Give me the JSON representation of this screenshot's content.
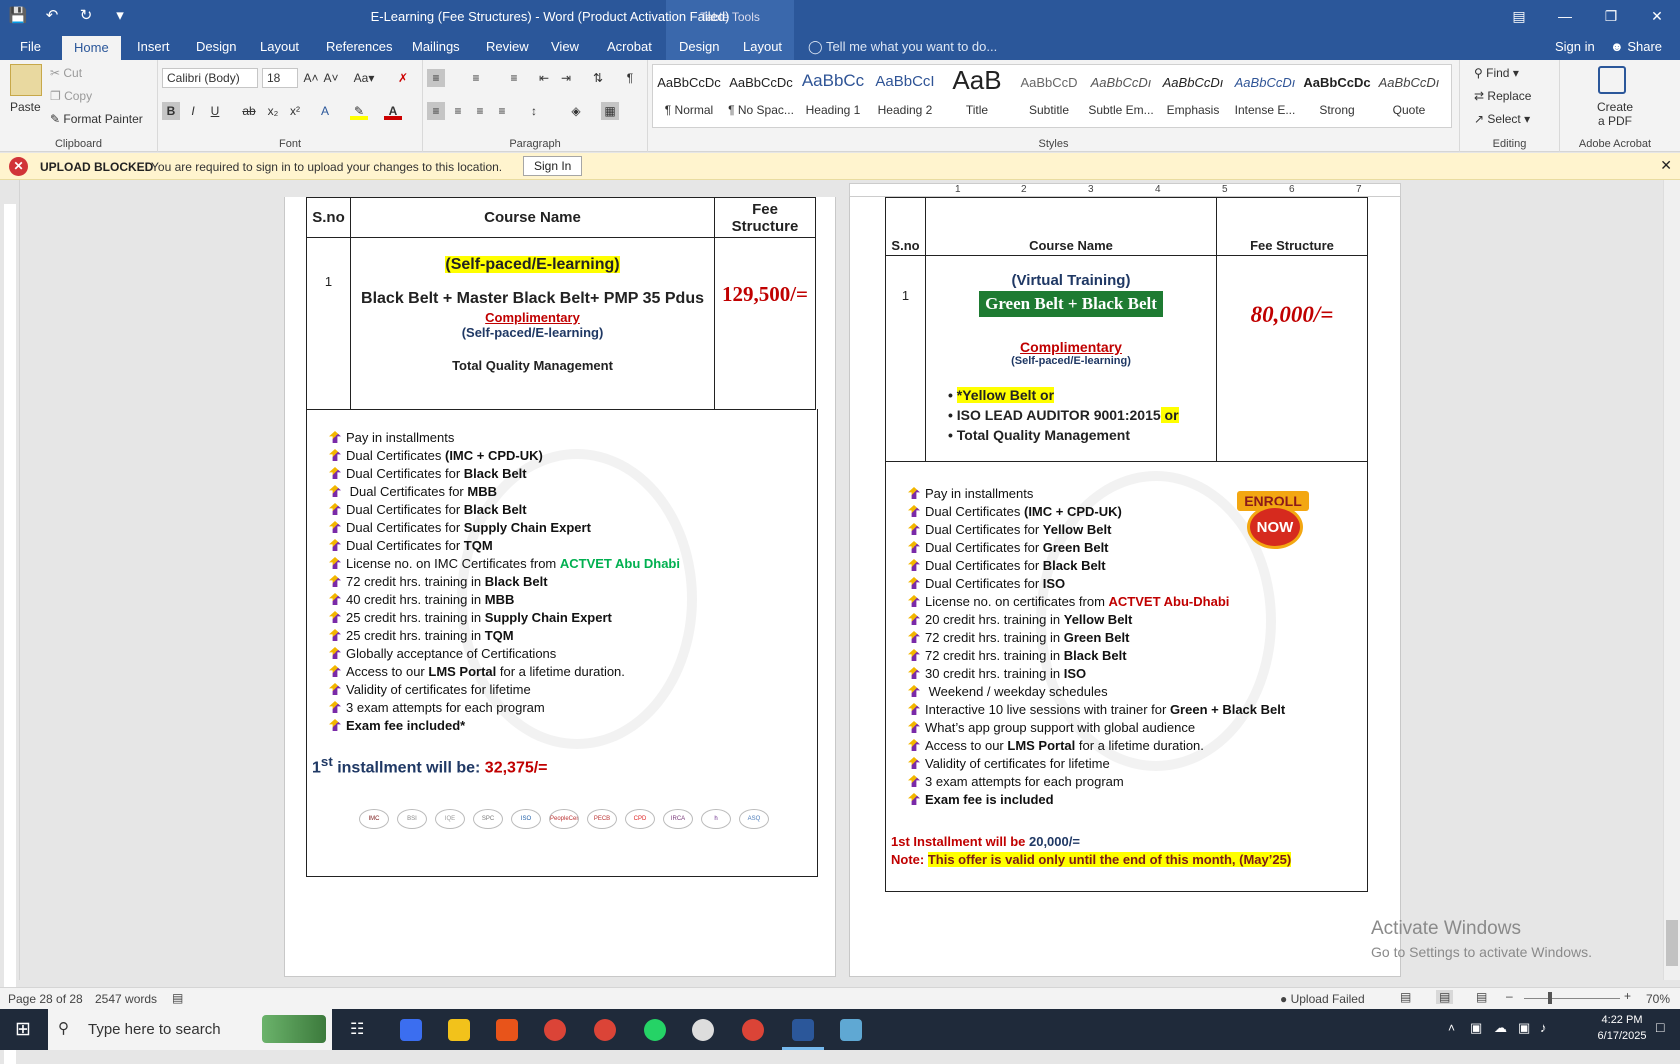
{
  "window": {
    "title": "E-Learning (Fee Structures) - Word (Product Activation Failed)",
    "context_tab": "Table Tools"
  },
  "tabs": [
    "File",
    "Home",
    "Insert",
    "Design",
    "Layout",
    "References",
    "Mailings",
    "Review",
    "View",
    "Acrobat",
    "Design",
    "Layout"
  ],
  "tellme": "Tell me what you want to do...",
  "signin": "Sign in",
  "share": "Share",
  "ribbon": {
    "clipboard": {
      "paste": "Paste",
      "cut": "Cut",
      "copy": "Copy",
      "format_painter": "Format Painter",
      "label": "Clipboard"
    },
    "font": {
      "name": "Calibri (Body)",
      "size": "18",
      "label": "Font"
    },
    "paragraph": {
      "label": "Paragraph"
    },
    "styles": {
      "label": "Styles",
      "items": [
        {
          "preview": "AaBbCcDc",
          "name": "¶ Normal"
        },
        {
          "preview": "AaBbCcDc",
          "name": "¶ No Spac..."
        },
        {
          "preview": "AaBbCc",
          "name": "Heading 1"
        },
        {
          "preview": "AaBbCcI",
          "name": "Heading 2"
        },
        {
          "preview": "AaB",
          "name": "Title"
        },
        {
          "preview": "AaBbCcD",
          "name": "Subtitle"
        },
        {
          "preview": "AaBbCcDı",
          "name": "Subtle Em..."
        },
        {
          "preview": "AaBbCcDı",
          "name": "Emphasis"
        },
        {
          "preview": "AaBbCcDı",
          "name": "Intense E..."
        },
        {
          "preview": "AaBbCcDc",
          "name": "Strong"
        },
        {
          "preview": "AaBbCcDı",
          "name": "Quote"
        }
      ]
    },
    "editing": {
      "find": "Find",
      "replace": "Replace",
      "select": "Select",
      "label": "Editing"
    },
    "acrobat": {
      "create": "Create\na PDF",
      "label": "Adobe Acrobat"
    }
  },
  "message": {
    "title": "UPLOAD BLOCKED",
    "text": "You are required to sign in to upload your changes to this location.",
    "button": "Sign In"
  },
  "ruler": [
    "1",
    "2",
    "3",
    "4",
    "5",
    "6",
    "7"
  ],
  "page1": {
    "headers": [
      "S.no",
      "Course Name",
      "Fee\nStructure"
    ],
    "sno": "1",
    "mode": "(Self-paced/E-learning)",
    "course": "Black Belt + Master Black Belt+  PMP 35 Pdus",
    "comp": "Complimentary",
    "comp_mode": "(Self-paced/E-learning)",
    "tqm": "Total Quality Management",
    "fee": "129,500/=",
    "bullets": [
      [
        "Pay in installments",
        ""
      ],
      [
        "Dual Certificates ",
        "(IMC + CPD-UK)"
      ],
      [
        "Dual Certificates for ",
        "Black Belt"
      ],
      [
        " Dual Certificates for ",
        "MBB"
      ],
      [
        "Dual Certificates for ",
        "Black Belt"
      ],
      [
        "Dual Certificates for ",
        "Supply Chain Expert"
      ],
      [
        "Dual Certificates for ",
        "TQM"
      ],
      [
        "License no. on IMC Certificates from ",
        "ACTVET Abu Dhabi"
      ],
      [
        "72 credit hrs. training in ",
        "Black Belt"
      ],
      [
        "40 credit hrs. training in ",
        "MBB"
      ],
      [
        "25 credit hrs. training in ",
        "Supply Chain Expert"
      ],
      [
        "25 credit hrs. training in ",
        "TQM"
      ],
      [
        "Globally acceptance of Certifications",
        ""
      ],
      [
        "Access to our ",
        "LMS Portal",
        " for a lifetime duration."
      ],
      [
        "Validity of certificates for lifetime",
        ""
      ],
      [
        "3 exam attempts for each program",
        ""
      ],
      [
        "",
        "Exam fee included*"
      ]
    ],
    "install_prefix": "1",
    "install_sup": "st",
    "install_text": " installment will be: ",
    "install_value": "32,375/=",
    "logos": [
      "IMC",
      "BSI",
      "IQE",
      "SPC",
      "ISO",
      "PeopleCert",
      "PECB",
      "CPD",
      "IRCA",
      "h",
      "ASQ"
    ]
  },
  "page2": {
    "headers": [
      "S.no",
      "Course Name",
      "Fee Structure"
    ],
    "sno": "1",
    "mode": "(Virtual Training)",
    "course": "Green Belt + Black Belt",
    "fee": "80,000/=",
    "comp": "Complimentary",
    "comp_mode": "(Self-paced/E-learning)",
    "options": [
      [
        "*Yellow Belt",
        " or"
      ],
      [
        "ISO LEAD AUDITOR 9001:2015",
        " or"
      ],
      [
        "Total Quality Management",
        ""
      ]
    ],
    "enroll": "ENROLL",
    "now": "NOW",
    "bullets": [
      [
        "Pay in installments",
        ""
      ],
      [
        "Dual Certificates ",
        "(IMC + CPD-UK)"
      ],
      [
        "Dual Certificates for ",
        "Yellow Belt"
      ],
      [
        "Dual Certificates for ",
        "Green Belt"
      ],
      [
        "Dual Certificates for ",
        "Black Belt"
      ],
      [
        "Dual Certificates for  ",
        "ISO"
      ],
      [
        "License no. on certificates from ",
        "ACTVET Abu-Dhabi"
      ],
      [
        "20 credit hrs. training in ",
        "Yellow Belt"
      ],
      [
        "72 credit hrs. training in ",
        "Green Belt"
      ],
      [
        "72 credit hrs. training in ",
        "Black Belt"
      ],
      [
        "30 credit hrs. training in  ",
        "ISO"
      ],
      [
        " Weekend / weekday schedules",
        ""
      ],
      [
        "Interactive 10 live sessions with trainer for ",
        "Green + Black Belt"
      ],
      [
        "What’s app group support with global audience",
        ""
      ],
      [
        "Access to our ",
        "LMS Portal",
        " for a lifetime duration."
      ],
      [
        "Validity of certificates for lifetime",
        ""
      ],
      [
        "3 exam attempts for each program",
        ""
      ],
      [
        "",
        "Exam fee is included"
      ]
    ],
    "install_label": "1st Installment will be ",
    "install_value": "20,000/=",
    "note_label": "Note: ",
    "note_text": "This offer is valid only until the end of this month, (May’25)"
  },
  "activate": {
    "line1": "Activate Windows",
    "line2": "Go to Settings to activate Windows."
  },
  "status": {
    "page": "Page 28 of 28",
    "words": "2547 words",
    "upload": "Upload Failed",
    "zoom": "70%"
  },
  "taskbar": {
    "search": "Type here to search",
    "time": "4:22 PM",
    "date": "6/17/2025"
  }
}
